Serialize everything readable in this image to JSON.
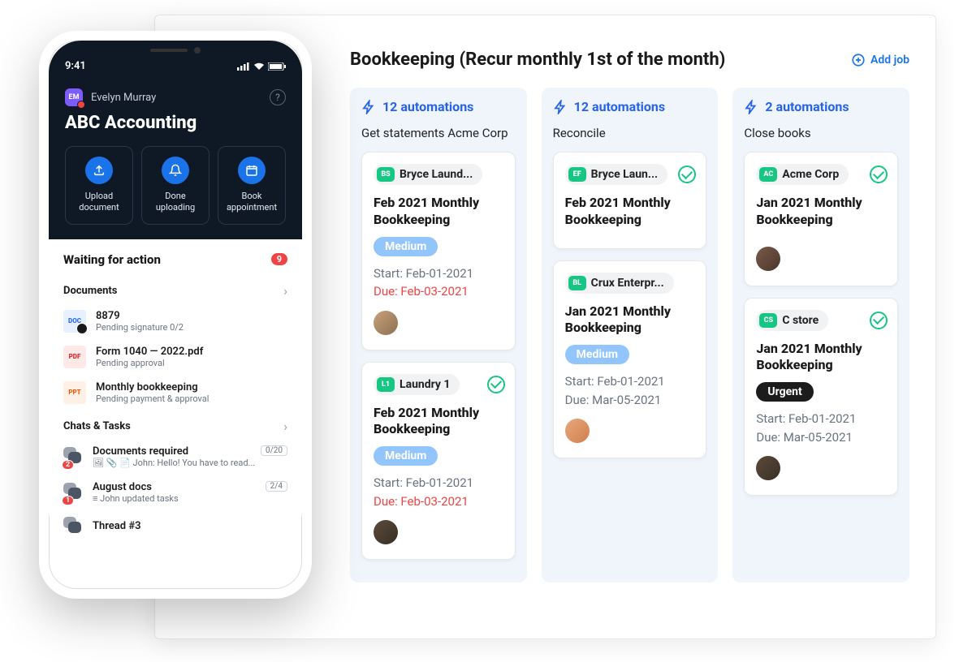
{
  "panel": {
    "title": "Bookkeeping (Recur monthly 1st of the month)",
    "addJob": "Add job"
  },
  "columns": [
    {
      "automations": "12 automations",
      "stage": "Get statements Acme Corp",
      "cards": [
        {
          "badge": "BS",
          "badgeColor": "#16c784",
          "client": "Bryce Laund...",
          "check": false,
          "title": "Feb 2021 Monthly Bookkeeping",
          "priority": "Medium",
          "prioClass": "prio-medium",
          "start": "Start: Feb-01-2021",
          "due": "Due: Feb-03-2021",
          "dueRed": true,
          "avColor": "linear-gradient(135deg,#c9a27a,#8b6f52)"
        },
        {
          "badge": "L1",
          "badgeColor": "#16c784",
          "client": "Laundry 1",
          "check": true,
          "title": "Feb 2021 Monthly Bookkeeping",
          "priority": "Medium",
          "prioClass": "prio-medium",
          "start": "Start: Feb-01-2021",
          "due": "Due: Feb-03-2021",
          "dueRed": true,
          "avColor": "linear-gradient(135deg,#5a4a3a,#3a2f26)"
        }
      ]
    },
    {
      "automations": "12 automations",
      "stage": "Reconcile",
      "cards": [
        {
          "badge": "EF",
          "badgeColor": "#16c784",
          "client": "Bryce Laun...",
          "check": true,
          "title": "Feb 2021 Monthly Bookkeeping",
          "priority": null
        },
        {
          "badge": "BL",
          "badgeColor": "#16c784",
          "client": "Crux Enterpr...",
          "check": false,
          "title": "Jan 2021 Monthly Bookkeeping",
          "priority": "Medium",
          "prioClass": "prio-medium",
          "start": "Start: Feb-01-2021",
          "due": "Due: Mar-05-2021",
          "dueRed": false,
          "avColor": "linear-gradient(135deg,#e8a87c,#d17f4f)"
        }
      ]
    },
    {
      "automations": "2 automations",
      "stage": "Close books",
      "cards": [
        {
          "badge": "AC",
          "badgeColor": "#16c784",
          "client": "Acme Corp",
          "check": true,
          "title": "Jan 2021 Monthly Bookkeeping",
          "priority": null,
          "avColor": "linear-gradient(135deg,#7a5a4a,#4a362a)"
        },
        {
          "badge": "CS",
          "badgeColor": "#16c784",
          "client": "C store",
          "check": true,
          "title": "Jan 2021 Monthly Bookkeeping",
          "priority": "Urgent",
          "prioClass": "prio-urgent",
          "start": "Start: Feb-01-2021",
          "due": "Due: Mar-05-2021",
          "dueRed": false,
          "avColor": "linear-gradient(135deg,#5a4a3a,#3a2f26)"
        }
      ]
    }
  ],
  "phone": {
    "time": "9:41",
    "userInitials": "EM",
    "userName": "Evelyn Murray",
    "brand": "ABC Accounting",
    "actions": [
      {
        "label": "Upload document"
      },
      {
        "label": "Done uploading"
      },
      {
        "label": "Book appointment"
      }
    ],
    "waiting": {
      "title": "Waiting for action",
      "count": "9"
    },
    "documentsHeader": "Documents",
    "documents": [
      {
        "icon": "DOC",
        "cls": "ico-doc",
        "name": "8879",
        "sub": "Pending signature 0/2"
      },
      {
        "icon": "PDF",
        "cls": "ico-pdf",
        "name": "Form 1040 — 2022.pdf",
        "sub": "Pending approval"
      },
      {
        "icon": "PPT",
        "cls": "ico-ppt",
        "name": "Monthly bookkeeping",
        "sub": "Pending payment & approval"
      }
    ],
    "chatsHeader": "Chats & Tasks",
    "chats": [
      {
        "title": "Documents required",
        "sub": "🖼 📎 📄 John: Hello! You have to read...",
        "chip": "0/20",
        "badge": "2"
      },
      {
        "title": "August docs",
        "sub": "≡ John updated tasks",
        "chip": "2/4",
        "badge": "1"
      },
      {
        "title": "Thread #3",
        "sub": "",
        "chip": null,
        "badge": null
      }
    ]
  }
}
